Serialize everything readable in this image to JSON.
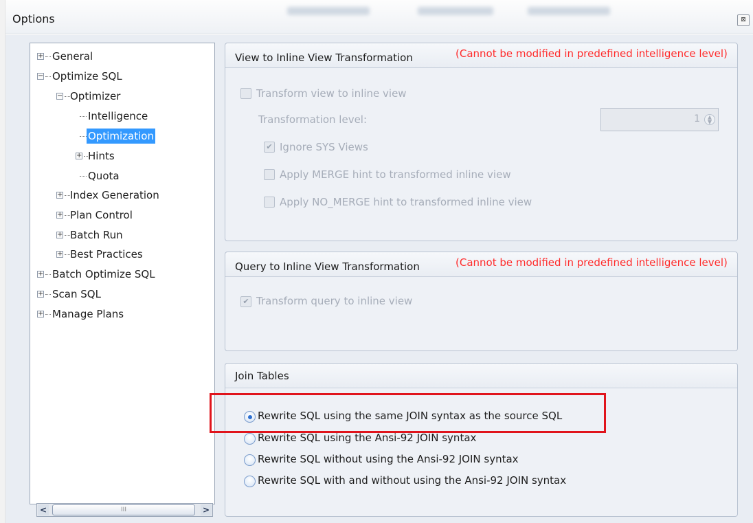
{
  "window": {
    "title": "Options",
    "close_glyph": "⊠"
  },
  "tree": {
    "items": [
      {
        "label": "General",
        "expander": "+"
      },
      {
        "label": "Optimize SQL",
        "expander": "−"
      },
      {
        "label": "Optimizer",
        "expander": "−"
      },
      {
        "label": "Intelligence",
        "expander": ""
      },
      {
        "label": "Optimization",
        "expander": "",
        "selected": true
      },
      {
        "label": "Hints",
        "expander": "+"
      },
      {
        "label": "Quota",
        "expander": ""
      },
      {
        "label": "Index Generation",
        "expander": "+"
      },
      {
        "label": "Plan Control",
        "expander": "+"
      },
      {
        "label": "Batch Run",
        "expander": "+"
      },
      {
        "label": "Best Practices",
        "expander": "+"
      },
      {
        "label": "Batch Optimize SQL",
        "expander": "+"
      },
      {
        "label": "Scan SQL",
        "expander": "+"
      },
      {
        "label": "Manage Plans",
        "expander": "+"
      }
    ],
    "scroll_left": "<",
    "scroll_right": ">",
    "scroll_grip": "III"
  },
  "view_group": {
    "title": "View to Inline View Transformation",
    "warning": "(Cannot be modified in predefined intelligence level)",
    "transform_label": "Transform view to inline view",
    "transform_checked": false,
    "level_label": "Transformation level:",
    "level_value": "1",
    "ignore_sys_label": "Ignore SYS Views",
    "ignore_sys_checked": true,
    "merge_label": "Apply MERGE hint to transformed inline view",
    "merge_checked": false,
    "no_merge_label": "Apply NO_MERGE hint to transformed inline view",
    "no_merge_checked": false
  },
  "query_group": {
    "title": "Query to Inline View Transformation",
    "warning": "(Cannot be modified in predefined intelligence level)",
    "transform_label": "Transform query to inline view",
    "transform_checked": true
  },
  "join_group": {
    "title": "Join Tables",
    "options": [
      {
        "label": "Rewrite SQL using the same JOIN syntax as the source SQL",
        "selected": true
      },
      {
        "label": "Rewrite SQL using the Ansi-92 JOIN syntax",
        "selected": false
      },
      {
        "label": "Rewrite SQL without using the Ansi-92 JOIN syntax",
        "selected": false
      },
      {
        "label": "Rewrite SQL with and without using the Ansi-92 JOIN syntax",
        "selected": false
      }
    ]
  },
  "colors": {
    "warning": "#ff2a2a",
    "selection": "#3399ff",
    "highlight_border": "#e0141c"
  }
}
